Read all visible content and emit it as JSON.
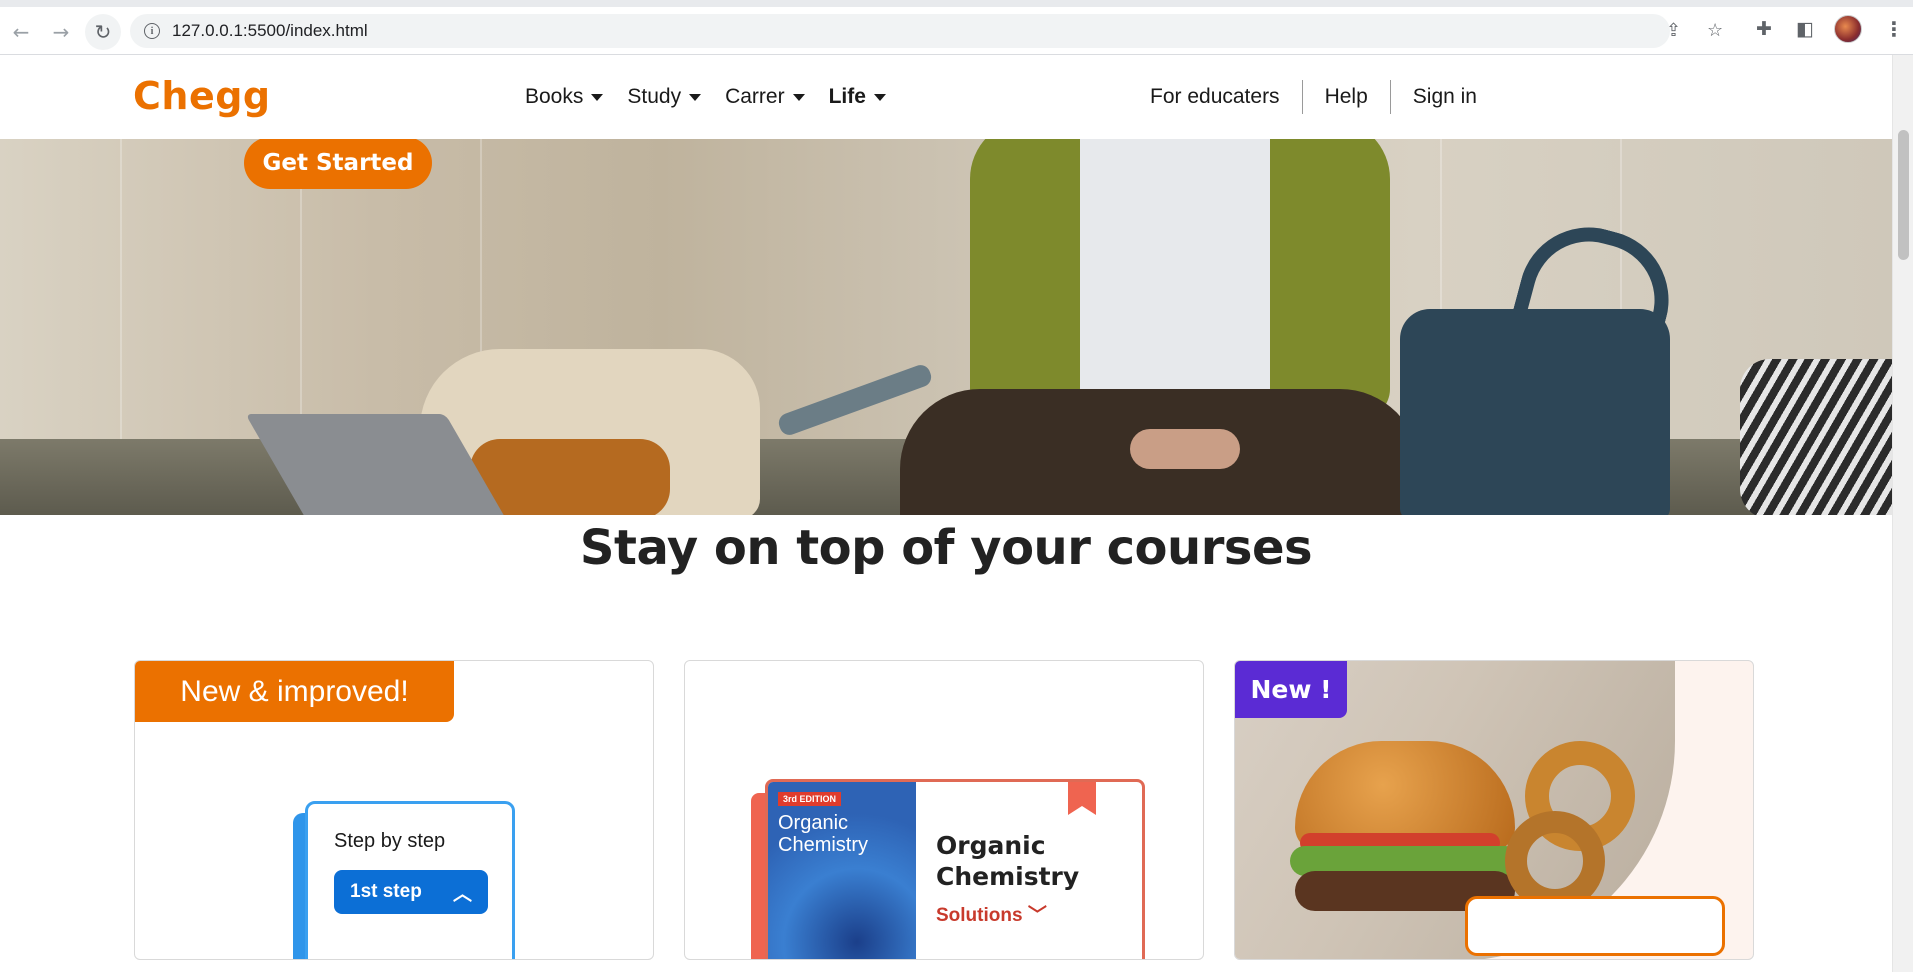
{
  "browser": {
    "url": "127.0.0.1:5500/index.html",
    "icons": [
      "back-arrow-icon",
      "forward-arrow-icon",
      "reload-icon",
      "info-icon",
      "share-icon",
      "star-icon",
      "extensions-icon",
      "side-panel-icon",
      "profile-avatar",
      "menu-icon"
    ]
  },
  "header": {
    "logo": "Chegg",
    "nav": [
      {
        "label": "Books"
      },
      {
        "label": "Study"
      },
      {
        "label": "Carrer"
      },
      {
        "label": "Life"
      }
    ],
    "right_links": [
      {
        "label": "For educaters"
      },
      {
        "label": "Help"
      },
      {
        "label": "Sign in"
      }
    ]
  },
  "hero": {
    "cta_label": "Get Started"
  },
  "section": {
    "title": "Stay on top of your courses"
  },
  "cards": [
    {
      "badge": "New & improved!",
      "step_title": "Step by step",
      "step_button": "1st step"
    },
    {
      "edition": "3rd EDITION",
      "cover_title": "Organic Chemistry",
      "book_title_line1": "Organic",
      "book_title_line2": "Chemistry",
      "book_sub": "Solutions"
    },
    {
      "badge": "New !"
    }
  ],
  "colors": {
    "brand_orange": "#eb7100",
    "badge_purple": "#5b2bd4",
    "step_blue": "#0c6fd6",
    "solutions_red": "#c83a2c"
  }
}
